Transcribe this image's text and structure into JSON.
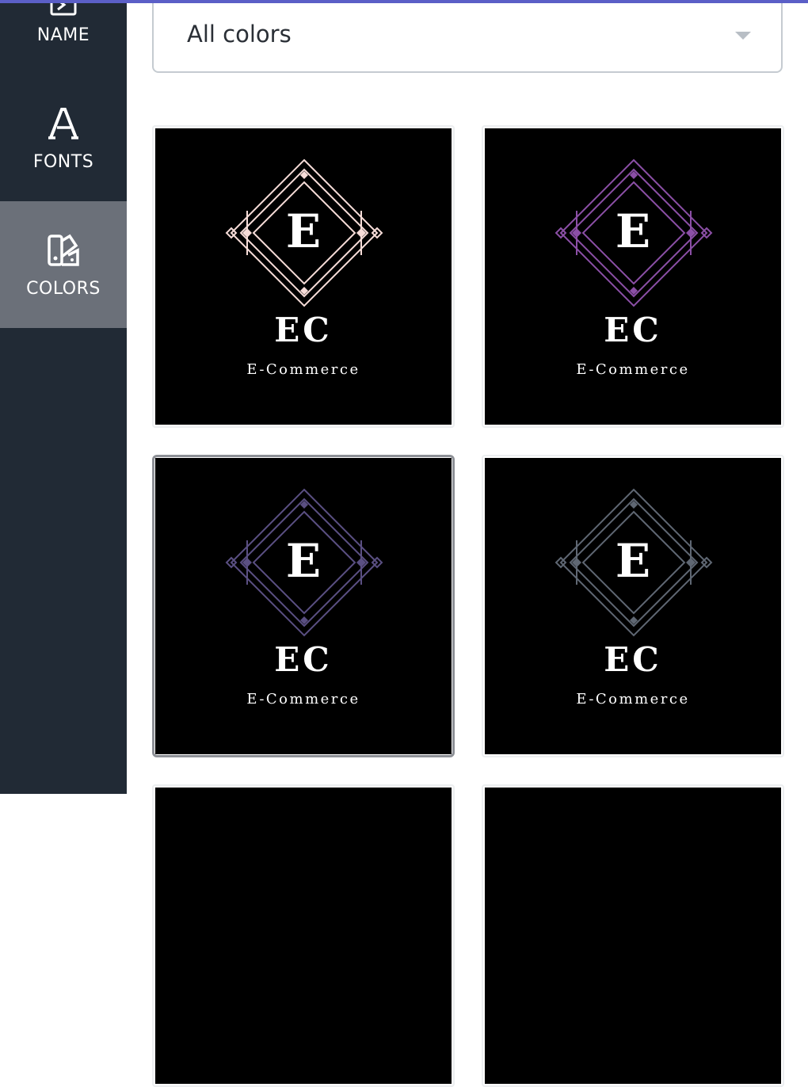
{
  "sidebar": {
    "items": [
      {
        "label": "NAME",
        "icon": "name-icon",
        "active": false
      },
      {
        "label": "FONTS",
        "icon": "font-icon",
        "active": false
      },
      {
        "label": "COLORS",
        "icon": "palette-icon",
        "active": true
      }
    ]
  },
  "colors": {
    "accent": "#5b5fc7",
    "sidebar_bg": "#212a35",
    "sidebar_active_bg": "#6b7079"
  },
  "filter": {
    "selected": "All colors"
  },
  "logos": [
    {
      "letter": "E",
      "initials": "EC",
      "tagline": "E-Commerce",
      "accent": "#f6dcd8",
      "selected": false
    },
    {
      "letter": "E",
      "initials": "EC",
      "tagline": "E-Commerce",
      "accent": "#8b4fa6",
      "selected": false
    },
    {
      "letter": "E",
      "initials": "EC",
      "tagline": "E-Commerce",
      "accent": "#5a4f82",
      "selected": true
    },
    {
      "letter": "E",
      "initials": "EC",
      "tagline": "E-Commerce",
      "accent": "#5f6773",
      "selected": false
    },
    {
      "letter": "",
      "initials": "",
      "tagline": "",
      "accent": "#000000",
      "selected": false
    },
    {
      "letter": "",
      "initials": "",
      "tagline": "",
      "accent": "#000000",
      "selected": false
    }
  ]
}
